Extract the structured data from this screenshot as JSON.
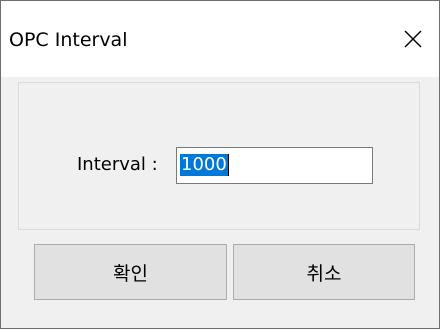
{
  "window": {
    "title": "OPC Interval",
    "close_icon": "close-icon"
  },
  "form": {
    "interval_label": "Interval :",
    "interval_value": "1000"
  },
  "buttons": {
    "ok_label": "확인",
    "cancel_label": "취소"
  },
  "colors": {
    "selection": "#0078d7",
    "dialog_bg": "#f0f0f0",
    "button_bg": "#e1e1e1"
  }
}
